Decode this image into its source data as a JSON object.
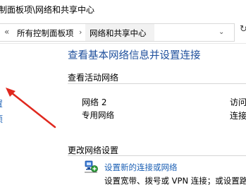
{
  "window": {
    "title": "制面板项\\网络和共享中心"
  },
  "address_bar": {
    "crumbs": [
      "所有控制面板项",
      "网络和共享中心"
    ],
    "separator": "›"
  },
  "left_pane": {
    "link1": "置",
    "link2": "项"
  },
  "main": {
    "heading": "查看基本网络信息并设置连接",
    "active_networks_label": "查看活动网络",
    "network": {
      "name": "网络 2",
      "type": "专用网络",
      "access_label": "访问",
      "connection_label": "连接"
    },
    "change_settings_label": "更改网络设置",
    "setup": {
      "link": "设置新的连接或网络",
      "description": "设置宽带、拨号或 VPN 连接；或设置路"
    }
  },
  "annotation": {
    "arrow_color": "#e0281e"
  }
}
